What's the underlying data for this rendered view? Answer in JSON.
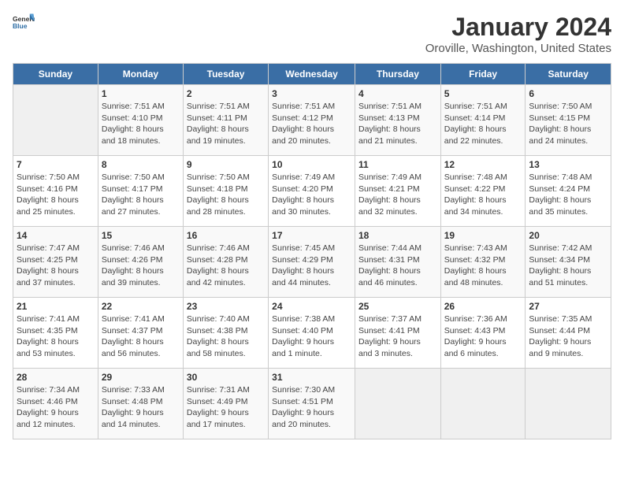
{
  "header": {
    "logo_general": "General",
    "logo_blue": "Blue",
    "title": "January 2024",
    "subtitle": "Oroville, Washington, United States"
  },
  "days_of_week": [
    "Sunday",
    "Monday",
    "Tuesday",
    "Wednesday",
    "Thursday",
    "Friday",
    "Saturday"
  ],
  "weeks": [
    [
      {
        "day": "",
        "info": ""
      },
      {
        "day": "1",
        "info": "Sunrise: 7:51 AM\nSunset: 4:10 PM\nDaylight: 8 hours\nand 18 minutes."
      },
      {
        "day": "2",
        "info": "Sunrise: 7:51 AM\nSunset: 4:11 PM\nDaylight: 8 hours\nand 19 minutes."
      },
      {
        "day": "3",
        "info": "Sunrise: 7:51 AM\nSunset: 4:12 PM\nDaylight: 8 hours\nand 20 minutes."
      },
      {
        "day": "4",
        "info": "Sunrise: 7:51 AM\nSunset: 4:13 PM\nDaylight: 8 hours\nand 21 minutes."
      },
      {
        "day": "5",
        "info": "Sunrise: 7:51 AM\nSunset: 4:14 PM\nDaylight: 8 hours\nand 22 minutes."
      },
      {
        "day": "6",
        "info": "Sunrise: 7:50 AM\nSunset: 4:15 PM\nDaylight: 8 hours\nand 24 minutes."
      }
    ],
    [
      {
        "day": "7",
        "info": "Sunrise: 7:50 AM\nSunset: 4:16 PM\nDaylight: 8 hours\nand 25 minutes."
      },
      {
        "day": "8",
        "info": "Sunrise: 7:50 AM\nSunset: 4:17 PM\nDaylight: 8 hours\nand 27 minutes."
      },
      {
        "day": "9",
        "info": "Sunrise: 7:50 AM\nSunset: 4:18 PM\nDaylight: 8 hours\nand 28 minutes."
      },
      {
        "day": "10",
        "info": "Sunrise: 7:49 AM\nSunset: 4:20 PM\nDaylight: 8 hours\nand 30 minutes."
      },
      {
        "day": "11",
        "info": "Sunrise: 7:49 AM\nSunset: 4:21 PM\nDaylight: 8 hours\nand 32 minutes."
      },
      {
        "day": "12",
        "info": "Sunrise: 7:48 AM\nSunset: 4:22 PM\nDaylight: 8 hours\nand 34 minutes."
      },
      {
        "day": "13",
        "info": "Sunrise: 7:48 AM\nSunset: 4:24 PM\nDaylight: 8 hours\nand 35 minutes."
      }
    ],
    [
      {
        "day": "14",
        "info": "Sunrise: 7:47 AM\nSunset: 4:25 PM\nDaylight: 8 hours\nand 37 minutes."
      },
      {
        "day": "15",
        "info": "Sunrise: 7:46 AM\nSunset: 4:26 PM\nDaylight: 8 hours\nand 39 minutes."
      },
      {
        "day": "16",
        "info": "Sunrise: 7:46 AM\nSunset: 4:28 PM\nDaylight: 8 hours\nand 42 minutes."
      },
      {
        "day": "17",
        "info": "Sunrise: 7:45 AM\nSunset: 4:29 PM\nDaylight: 8 hours\nand 44 minutes."
      },
      {
        "day": "18",
        "info": "Sunrise: 7:44 AM\nSunset: 4:31 PM\nDaylight: 8 hours\nand 46 minutes."
      },
      {
        "day": "19",
        "info": "Sunrise: 7:43 AM\nSunset: 4:32 PM\nDaylight: 8 hours\nand 48 minutes."
      },
      {
        "day": "20",
        "info": "Sunrise: 7:42 AM\nSunset: 4:34 PM\nDaylight: 8 hours\nand 51 minutes."
      }
    ],
    [
      {
        "day": "21",
        "info": "Sunrise: 7:41 AM\nSunset: 4:35 PM\nDaylight: 8 hours\nand 53 minutes."
      },
      {
        "day": "22",
        "info": "Sunrise: 7:41 AM\nSunset: 4:37 PM\nDaylight: 8 hours\nand 56 minutes."
      },
      {
        "day": "23",
        "info": "Sunrise: 7:40 AM\nSunset: 4:38 PM\nDaylight: 8 hours\nand 58 minutes."
      },
      {
        "day": "24",
        "info": "Sunrise: 7:38 AM\nSunset: 4:40 PM\nDaylight: 9 hours\nand 1 minute."
      },
      {
        "day": "25",
        "info": "Sunrise: 7:37 AM\nSunset: 4:41 PM\nDaylight: 9 hours\nand 3 minutes."
      },
      {
        "day": "26",
        "info": "Sunrise: 7:36 AM\nSunset: 4:43 PM\nDaylight: 9 hours\nand 6 minutes."
      },
      {
        "day": "27",
        "info": "Sunrise: 7:35 AM\nSunset: 4:44 PM\nDaylight: 9 hours\nand 9 minutes."
      }
    ],
    [
      {
        "day": "28",
        "info": "Sunrise: 7:34 AM\nSunset: 4:46 PM\nDaylight: 9 hours\nand 12 minutes."
      },
      {
        "day": "29",
        "info": "Sunrise: 7:33 AM\nSunset: 4:48 PM\nDaylight: 9 hours\nand 14 minutes."
      },
      {
        "day": "30",
        "info": "Sunrise: 7:31 AM\nSunset: 4:49 PM\nDaylight: 9 hours\nand 17 minutes."
      },
      {
        "day": "31",
        "info": "Sunrise: 7:30 AM\nSunset: 4:51 PM\nDaylight: 9 hours\nand 20 minutes."
      },
      {
        "day": "",
        "info": ""
      },
      {
        "day": "",
        "info": ""
      },
      {
        "day": "",
        "info": ""
      }
    ]
  ]
}
